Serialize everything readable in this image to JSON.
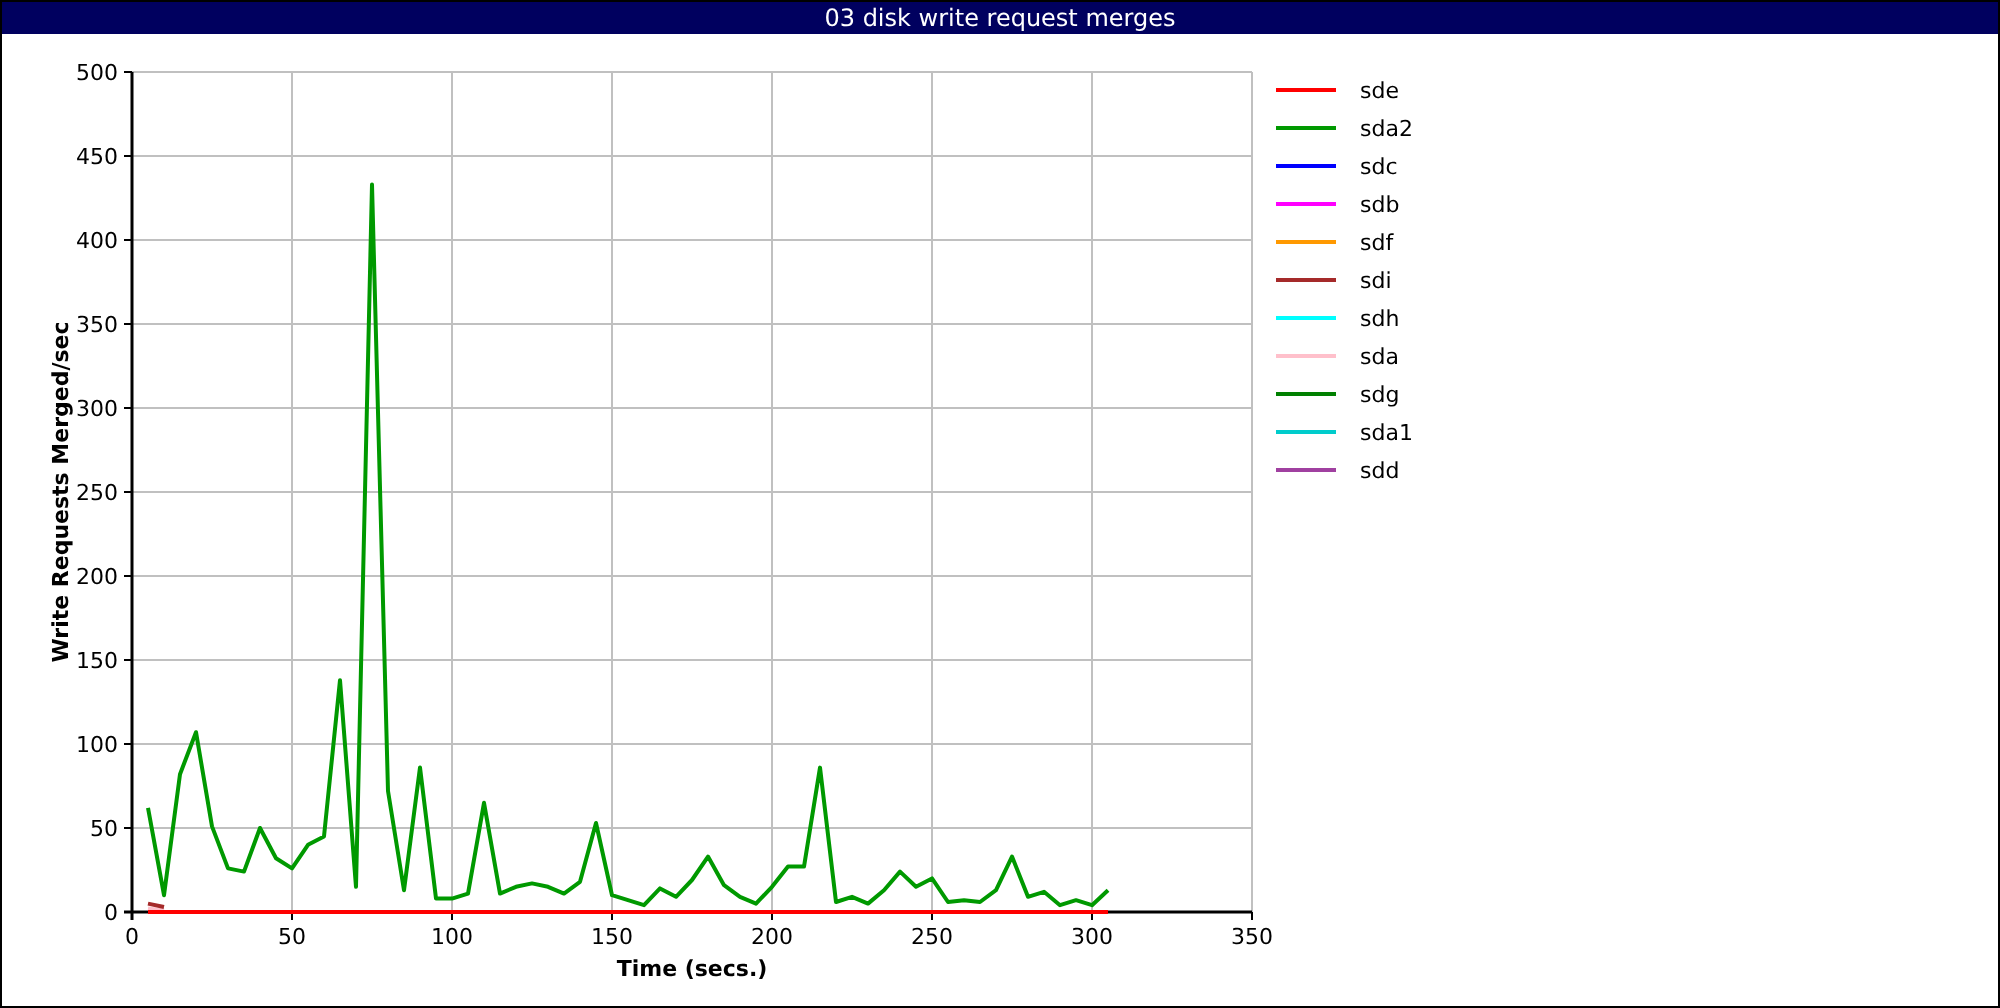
{
  "window": {
    "title": "03 disk write request merges"
  },
  "chart_data": {
    "type": "line",
    "xlabel": "Time (secs.)",
    "ylabel": "Write Requests Merged/sec",
    "grid": true,
    "legend": true,
    "x": [
      5,
      10,
      15,
      20,
      25,
      30,
      35,
      40,
      45,
      50,
      55,
      60,
      65,
      70,
      75,
      80,
      85,
      90,
      95,
      100,
      105,
      110,
      115,
      120,
      125,
      130,
      135,
      140,
      145,
      150,
      155,
      160,
      165,
      170,
      175,
      180,
      185,
      190,
      195,
      200,
      205,
      210,
      215,
      220,
      225,
      230,
      235,
      240,
      245,
      250,
      255,
      260,
      265,
      270,
      275,
      280,
      285,
      290,
      295,
      300,
      305
    ],
    "xlim": [
      0,
      350
    ],
    "ylim": [
      0,
      500
    ],
    "xticks": [
      0,
      50,
      100,
      150,
      200,
      250,
      300,
      350
    ],
    "yticks": [
      0,
      50,
      100,
      150,
      200,
      250,
      300,
      350,
      400,
      450,
      500
    ],
    "series": [
      {
        "name": "sde",
        "color": "#ff0000",
        "values": [
          0,
          0,
          0,
          0,
          0,
          0,
          0,
          0,
          0,
          0,
          0,
          0,
          0,
          0,
          0,
          0,
          0,
          0,
          0,
          0,
          0,
          0,
          0,
          0,
          0,
          0,
          0,
          0,
          0,
          0,
          0,
          0,
          0,
          0,
          0,
          0,
          0,
          0,
          0,
          0,
          0,
          0,
          0,
          0,
          0,
          0,
          0,
          0,
          0,
          0,
          0,
          0,
          0,
          0,
          0,
          0,
          0,
          0,
          0,
          0,
          0
        ]
      },
      {
        "name": "sda2",
        "color": "#009900",
        "values": [
          62,
          10,
          82,
          107,
          51,
          26,
          24,
          50,
          32,
          26,
          40,
          45,
          138,
          15,
          433,
          72,
          13,
          86,
          8,
          8,
          11,
          65,
          11,
          15,
          17,
          15,
          11,
          18,
          53,
          10,
          7,
          4,
          14,
          9,
          19,
          33,
          16,
          9,
          5,
          15,
          27,
          27,
          86,
          6,
          9,
          5,
          13,
          24,
          15,
          20,
          6,
          7,
          6,
          13,
          33,
          9,
          12,
          4,
          7,
          4,
          13
        ]
      },
      {
        "name": "sdc",
        "color": "#0000ff",
        "values": [
          null,
          null,
          null,
          null,
          null,
          null,
          null,
          null,
          null,
          null,
          null,
          null,
          null,
          null,
          null,
          null,
          null,
          null,
          null,
          null,
          null,
          null,
          null,
          null,
          null,
          null,
          null,
          null,
          null,
          null,
          null,
          null,
          null,
          null,
          null,
          null,
          null,
          null,
          null,
          null,
          null,
          null,
          null,
          null,
          null,
          null,
          null,
          null,
          null,
          null,
          null,
          null,
          null,
          null,
          null,
          null,
          null,
          null,
          null,
          null,
          null
        ]
      },
      {
        "name": "sdb",
        "color": "#ff00ff",
        "values": [
          null,
          null,
          null,
          null,
          null,
          null,
          null,
          null,
          null,
          null,
          null,
          null,
          null,
          null,
          null,
          null,
          null,
          null,
          null,
          null,
          null,
          null,
          null,
          null,
          null,
          null,
          null,
          null,
          null,
          null,
          null,
          null,
          null,
          null,
          null,
          null,
          null,
          null,
          null,
          null,
          null,
          null,
          null,
          null,
          null,
          null,
          null,
          null,
          null,
          null,
          null,
          null,
          null,
          null,
          null,
          null,
          null,
          null,
          null,
          null,
          null
        ]
      },
      {
        "name": "sdf",
        "color": "#ff9900",
        "values": [
          null,
          null,
          null,
          null,
          null,
          null,
          null,
          null,
          null,
          null,
          null,
          null,
          null,
          null,
          null,
          null,
          null,
          null,
          null,
          null,
          null,
          null,
          null,
          null,
          null,
          null,
          null,
          null,
          null,
          null,
          null,
          null,
          null,
          null,
          null,
          null,
          null,
          null,
          null,
          null,
          null,
          null,
          null,
          null,
          null,
          null,
          null,
          null,
          null,
          null,
          null,
          null,
          null,
          null,
          null,
          null,
          null,
          null,
          null,
          null,
          null
        ]
      },
      {
        "name": "sdi",
        "color": "#a52a2a",
        "values": [
          5,
          3,
          null,
          null,
          null,
          null,
          null,
          null,
          null,
          null,
          null,
          null,
          null,
          null,
          null,
          null,
          null,
          null,
          null,
          null,
          null,
          null,
          null,
          null,
          null,
          null,
          null,
          null,
          null,
          null,
          null,
          null,
          null,
          null,
          null,
          null,
          null,
          null,
          null,
          null,
          null,
          null,
          null,
          null,
          null,
          null,
          null,
          null,
          null,
          null,
          null,
          null,
          null,
          null,
          null,
          null,
          null,
          null,
          null,
          null,
          null
        ]
      },
      {
        "name": "sdh",
        "color": "#00ffff",
        "values": [
          null,
          null,
          null,
          null,
          null,
          null,
          null,
          null,
          null,
          null,
          null,
          null,
          null,
          null,
          null,
          null,
          null,
          null,
          null,
          null,
          null,
          null,
          null,
          null,
          null,
          null,
          null,
          null,
          null,
          null,
          null,
          null,
          null,
          null,
          null,
          null,
          null,
          null,
          null,
          null,
          null,
          null,
          null,
          null,
          null,
          null,
          null,
          null,
          null,
          null,
          null,
          null,
          null,
          null,
          null,
          null,
          null,
          null,
          null,
          null,
          null
        ]
      },
      {
        "name": "sda",
        "color": "#ffc0cb",
        "values": [
          2,
          1,
          null,
          null,
          null,
          null,
          null,
          null,
          null,
          null,
          null,
          null,
          null,
          null,
          null,
          null,
          null,
          null,
          null,
          null,
          null,
          null,
          null,
          null,
          null,
          null,
          null,
          null,
          null,
          null,
          null,
          null,
          null,
          null,
          null,
          null,
          null,
          null,
          null,
          null,
          null,
          null,
          null,
          null,
          null,
          null,
          null,
          null,
          null,
          null,
          null,
          null,
          null,
          null,
          null,
          null,
          null,
          null,
          null,
          null,
          null
        ]
      },
      {
        "name": "sdg",
        "color": "#008000",
        "values": [
          null,
          null,
          null,
          null,
          null,
          null,
          null,
          null,
          null,
          null,
          null,
          null,
          null,
          null,
          null,
          null,
          null,
          null,
          null,
          null,
          null,
          null,
          null,
          null,
          null,
          null,
          null,
          null,
          null,
          null,
          null,
          null,
          null,
          null,
          null,
          null,
          null,
          null,
          null,
          null,
          null,
          null,
          null,
          null,
          null,
          null,
          null,
          null,
          null,
          null,
          null,
          null,
          null,
          null,
          null,
          null,
          null,
          null,
          null,
          null,
          null
        ]
      },
      {
        "name": "sda1",
        "color": "#00cccc",
        "values": [
          null,
          null,
          null,
          null,
          null,
          null,
          null,
          null,
          null,
          null,
          null,
          null,
          null,
          null,
          null,
          null,
          null,
          null,
          null,
          null,
          null,
          null,
          null,
          null,
          null,
          null,
          null,
          null,
          null,
          null,
          null,
          null,
          null,
          null,
          null,
          null,
          null,
          null,
          null,
          null,
          null,
          null,
          null,
          null,
          null,
          null,
          null,
          null,
          null,
          null,
          null,
          null,
          null,
          null,
          null,
          null,
          null,
          null,
          null,
          null,
          null
        ]
      },
      {
        "name": "sdd",
        "color": "#a040a0",
        "values": [
          null,
          null,
          null,
          null,
          null,
          null,
          null,
          null,
          null,
          null,
          null,
          null,
          null,
          null,
          null,
          null,
          null,
          null,
          null,
          null,
          null,
          null,
          null,
          null,
          null,
          null,
          null,
          null,
          null,
          null,
          null,
          null,
          null,
          null,
          null,
          null,
          null,
          null,
          null,
          null,
          null,
          null,
          null,
          null,
          null,
          null,
          null,
          null,
          null,
          null,
          null,
          null,
          null,
          null,
          null,
          null,
          null,
          null,
          null,
          null,
          null
        ]
      }
    ]
  }
}
